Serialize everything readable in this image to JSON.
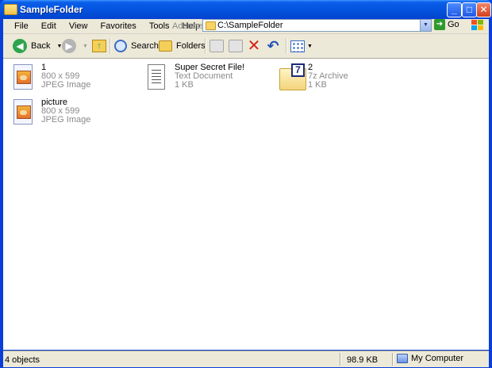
{
  "window": {
    "title": "SampleFolder",
    "controls": {
      "minimize": "_",
      "maximize": "□",
      "close": "✕"
    }
  },
  "menu": {
    "items": [
      "File",
      "Edit",
      "View",
      "Favorites",
      "Tools",
      "Help"
    ],
    "address_label": "Address",
    "address_value": "C:\\SampleFolder",
    "go_label": "Go"
  },
  "toolbar": {
    "back_label": "Back",
    "search_label": "Search",
    "folders_label": "Folders"
  },
  "files": [
    {
      "name": "1",
      "meta1": "800 x 599",
      "meta2": "JPEG Image",
      "icon": "jpeg-image-icon"
    },
    {
      "name": "Super Secret File!",
      "meta1": "Text Document",
      "meta2": "1 KB",
      "icon": "text-document-icon"
    },
    {
      "name": "2",
      "meta1": "7z Archive",
      "meta2": "1 KB",
      "icon": "archive-7z-icon"
    },
    {
      "name": "picture",
      "meta1": "800 x 599",
      "meta2": "JPEG Image",
      "icon": "jpeg-image-icon"
    }
  ],
  "zip_badge": "7",
  "status": {
    "objects": "4 objects",
    "size": "98.9 KB",
    "location": "My Computer"
  },
  "colors": {
    "title_bar": "#0454e0",
    "chrome": "#ece9d8",
    "close_button": "#d2401c",
    "meta_text": "#8a8a8a"
  }
}
